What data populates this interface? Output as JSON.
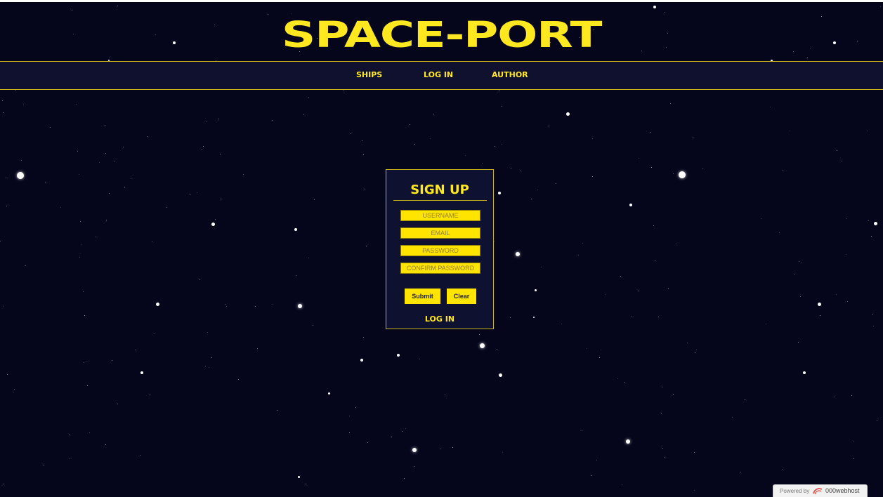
{
  "site": {
    "title": "SPACE-PORT"
  },
  "nav": {
    "items": [
      {
        "label": "SHIPS"
      },
      {
        "label": "LOG IN"
      },
      {
        "label": "AUTHOR"
      }
    ]
  },
  "signup": {
    "title": "SIGN UP",
    "fields": {
      "username_placeholder": "USERNAME",
      "email_placeholder": "EMAIL",
      "password_placeholder": "PASSWORD",
      "confirm_password_placeholder": "CONFIRM PASSWORD"
    },
    "submit_label": "Submit",
    "clear_label": "Clear",
    "login_link": "LOG IN"
  },
  "footer_badge": {
    "powered_by": "Powered by",
    "brand": "000webhost",
    "icon": "000webhost-logo-icon"
  },
  "colors": {
    "background": "#05051b",
    "accent": "#ffe81f",
    "panel": "#0f1130"
  }
}
